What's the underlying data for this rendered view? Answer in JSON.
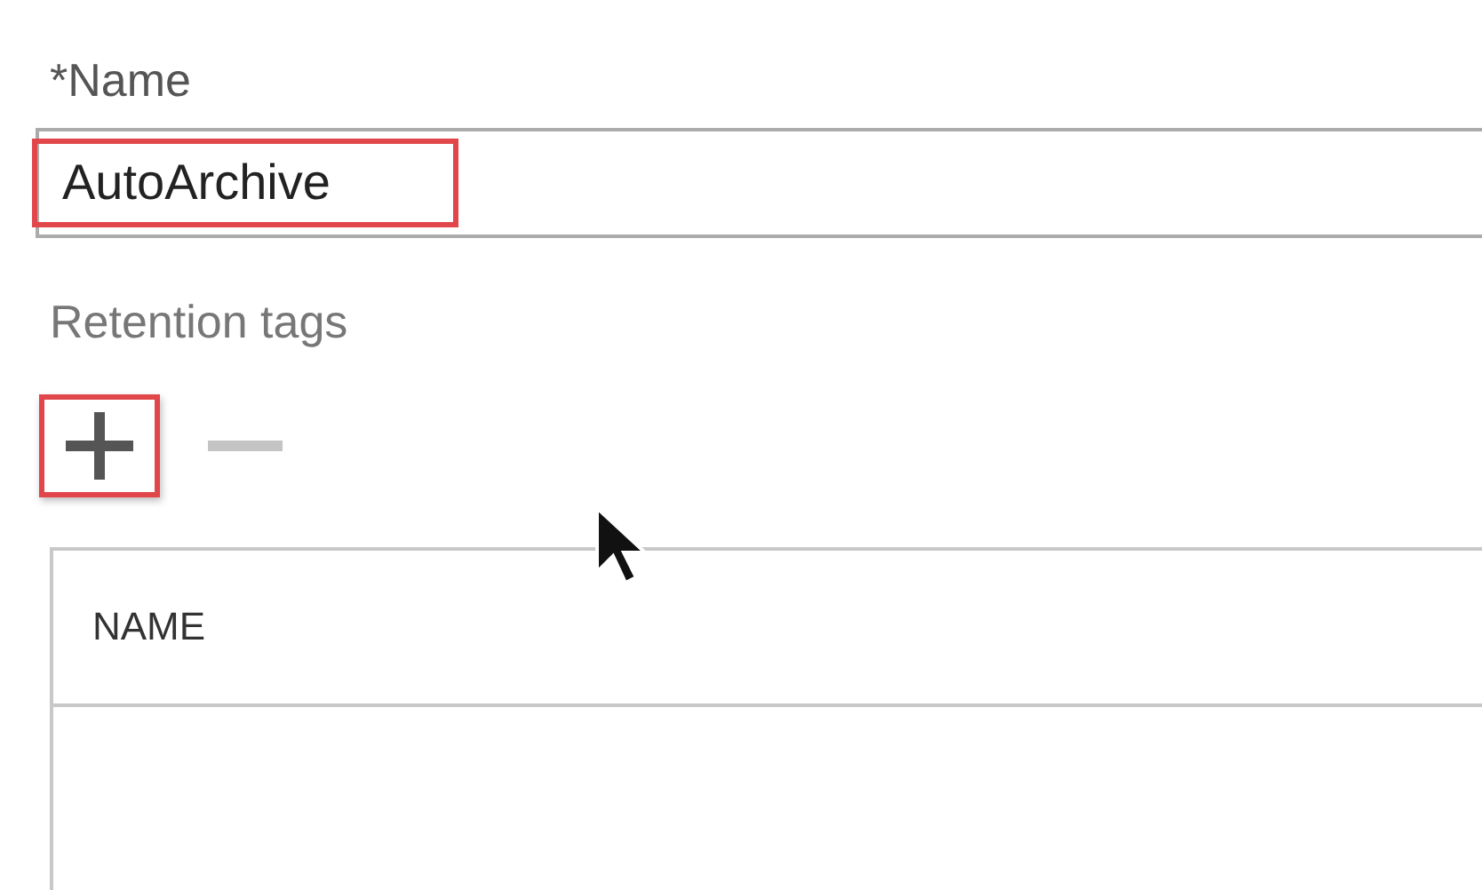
{
  "name_field": {
    "label": "*Name",
    "value": "AutoArchive",
    "highlighted": true
  },
  "retention_tags": {
    "label": "Retention tags",
    "add_button": {
      "highlighted": true,
      "disabled": false
    },
    "remove_button": {
      "highlighted": false,
      "disabled": true
    }
  },
  "table": {
    "columns": [
      "NAME"
    ]
  }
}
